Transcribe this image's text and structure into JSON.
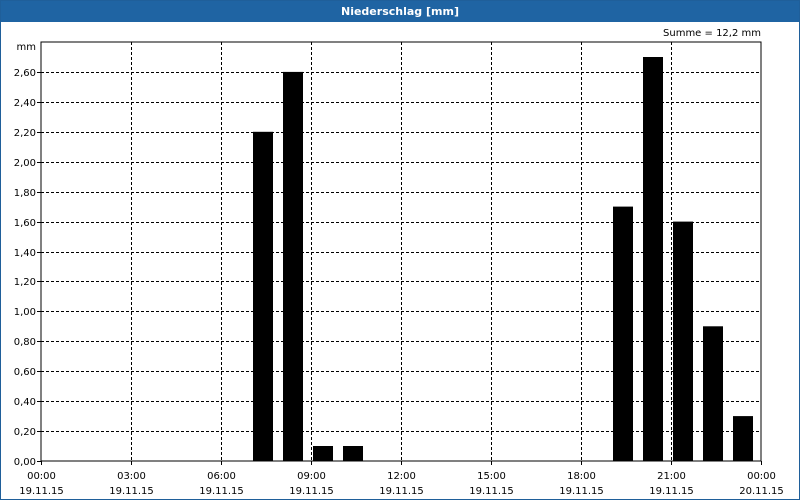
{
  "window": {
    "title": "Niederschlag [mm]"
  },
  "chart_data": {
    "type": "bar",
    "title": "Niederschlag [mm]",
    "ylabel": "mm",
    "annotation": "Summe = 12,2 mm",
    "ylim": [
      0,
      2.8
    ],
    "yticks": [
      "0,00",
      "0,20",
      "0,40",
      "0,60",
      "0,80",
      "1,00",
      "1,20",
      "1,40",
      "1,60",
      "1,80",
      "2,00",
      "2,20",
      "2,40",
      "2,60"
    ],
    "xlim_hours": [
      0,
      24
    ],
    "xticks": [
      {
        "time": "00:00",
        "date": "19.11.15"
      },
      {
        "time": "03:00",
        "date": "19.11.15"
      },
      {
        "time": "06:00",
        "date": "19.11.15"
      },
      {
        "time": "09:00",
        "date": "19.11.15"
      },
      {
        "time": "12:00",
        "date": "19.11.15"
      },
      {
        "time": "15:00",
        "date": "19.11.15"
      },
      {
        "time": "18:00",
        "date": "19.11.15"
      },
      {
        "time": "21:00",
        "date": "19.11.15"
      },
      {
        "time": "00:00",
        "date": "20.11.15"
      }
    ],
    "bars": [
      {
        "hour": 7,
        "value": 2.2
      },
      {
        "hour": 8,
        "value": 2.6
      },
      {
        "hour": 9,
        "value": 0.1
      },
      {
        "hour": 10,
        "value": 0.1
      },
      {
        "hour": 19,
        "value": 1.7
      },
      {
        "hour": 20,
        "value": 2.7
      },
      {
        "hour": 21,
        "value": 1.6
      },
      {
        "hour": 22,
        "value": 0.9
      },
      {
        "hour": 23,
        "value": 0.3
      }
    ],
    "grid": true,
    "bar_color": "#000000"
  }
}
